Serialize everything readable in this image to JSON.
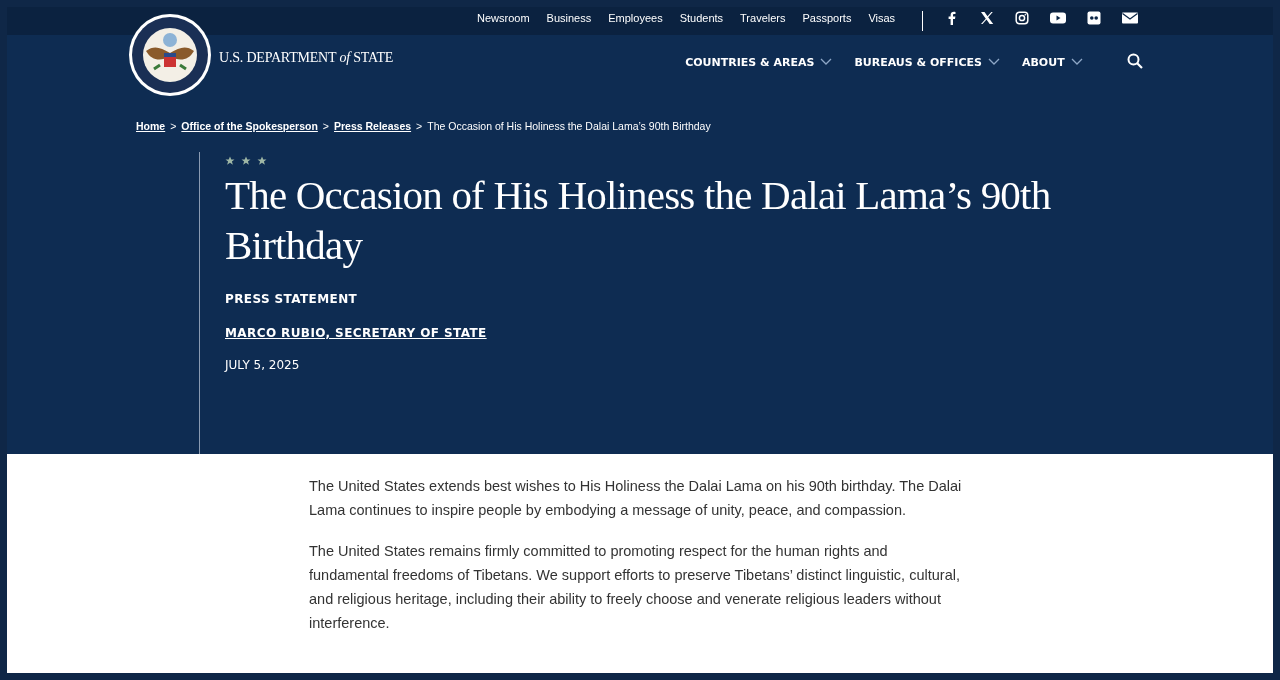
{
  "utility_nav": {
    "links": [
      "Newsroom",
      "Business",
      "Employees",
      "Students",
      "Travelers",
      "Passports",
      "Visas"
    ],
    "social": [
      {
        "kind": "facebook"
      },
      {
        "kind": "x"
      },
      {
        "kind": "instagram"
      },
      {
        "kind": "youtube"
      },
      {
        "kind": "flickr"
      },
      {
        "kind": "email"
      }
    ]
  },
  "header": {
    "logo_text": "U.S. DEPARTMENT *of* STATE",
    "menu": [
      {
        "label": "COUNTRIES & AREAS",
        "has_dropdown": true
      },
      {
        "label": "BUREAUS & OFFICES",
        "has_dropdown": true
      },
      {
        "label": "ABOUT",
        "has_dropdown": true
      }
    ]
  },
  "breadcrumb": [
    {
      "label": "Home",
      "link": true
    },
    {
      "separator": ">",
      "label": "Office of the Spokesperson",
      "link": true
    },
    {
      "separator": ">",
      "label": "Press Releases",
      "link": true
    },
    {
      "separator": ">",
      "label": "The Occasion of His Holiness the Dalai Lama’s 90th Birthday",
      "link": false
    }
  ],
  "article": {
    "title": "The Occasion of His Holiness the Dalai Lama’s 90th Birthday",
    "type": "PRESS STATEMENT",
    "author": "MARCO RUBIO, SECRETARY OF STATE",
    "date": "JULY 5, 2025",
    "paragraphs": [
      "The United States extends best wishes to His Holiness the Dalai Lama on his 90th birthday. The Dalai Lama continues to inspire people by embodying a message of unity, peace, and compassion.",
      "The United States remains firmly committed to promoting respect for the human rights and fundamental freedoms of Tibetans. We support efforts to preserve Tibetans’ distinct linguistic, cultural, and religious heritage, including their ability to freely choose and venerate religious leaders without interference."
    ]
  }
}
